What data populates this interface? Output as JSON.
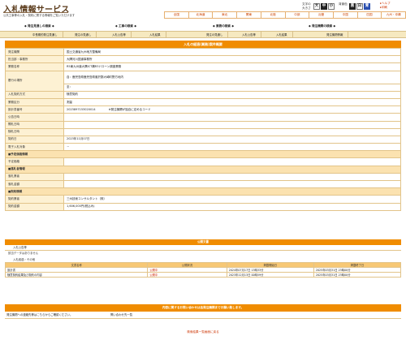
{
  "header": {
    "title": "入札情報サービス",
    "subtitle": "公共工事等の入札・契約に関する情報をご覧いただけます",
    "font_size_label": "文字の大きさ",
    "font_sizes": [
      "大",
      "中",
      "小"
    ],
    "color_label": "背景色",
    "colors": [
      "黒",
      "白",
      "青"
    ],
    "help": "ヘルプ",
    "print": "印刷"
  },
  "regions": [
    "全国",
    "北海道",
    "東北",
    "関東",
    "北陸",
    "中部",
    "近畿",
    "中国",
    "四国",
    "九州・沖縄"
  ],
  "nav": {
    "heads": [
      "◆ 発注見通しの検索 ◆",
      "◆ 工事の検索 ◆",
      "◆ 業務の検索 ◆",
      "◆ 発注機関の検索 ◆"
    ],
    "items": [
      "中長期的発注見通し",
      "発注の見通し",
      "入札公告等",
      "入札結果",
      "発注の見通し",
      "入札公告等",
      "入札結果",
      "発注機関情報"
    ]
  },
  "detail": {
    "title": "入札の経過(業務)案件概要",
    "rows": [
      {
        "label": "発注機関",
        "value": "国土交通省九州地方整備局"
      },
      {
        "label": "担当部・事務所",
        "value": "大隅河川国道事務所"
      },
      {
        "label": "業務名称",
        "value": "R5東九州道大隅ICT構R3ドローン調査業務"
      },
      {
        "label": "履行の場所",
        "value": "自：鹿児島県鹿児島県曽於郡大崎町野方地内",
        "value2": "至："
      },
      {
        "label": "入札契約方式",
        "value": "随意契約"
      },
      {
        "label": "業務区分",
        "value": "測量"
      },
      {
        "label": "設計書番号",
        "value": "2023897153020014",
        "note": "※発注機関が独自に定めるコード"
      },
      {
        "label": "公告日時",
        "value": ""
      },
      {
        "label": "開札日時",
        "value": ""
      },
      {
        "label": "随札日時",
        "value": ""
      },
      {
        "label": "契約日",
        "value": "2023年11月07日"
      },
      {
        "label": "電子入札対象",
        "value": "－"
      }
    ],
    "sections": [
      {
        "title": "■予定価格情報",
        "rows": [
          {
            "label": "予定価格",
            "value": ""
          }
        ]
      },
      {
        "title": "■落札者情報",
        "rows": [
          {
            "label": "落札業者",
            "value": ""
          },
          {
            "label": "落札金額",
            "value": ""
          }
        ]
      },
      {
        "title": "■契約情報",
        "rows": [
          {
            "label": "契約業者",
            "value": "三州技術コンサルタント（株）"
          },
          {
            "label": "契約金額",
            "value": "1,606,000円(税込み)"
          }
        ]
      }
    ]
  },
  "public_info": {
    "title": "公開文書",
    "tender_docs_head": "入札公告等",
    "tender_docs_empty": "該当データはありません",
    "others_head": "入札経過・その他",
    "columns": [
      "文書名称",
      "公開状況",
      "掲載開始日",
      "掲載終了日"
    ],
    "rows": [
      {
        "name": "設計書",
        "status": "公開中",
        "start": "2024年07月17日 13時33分",
        "end": "2025年03月31日 23時00分"
      },
      {
        "name": "随意契約結果及び契約の内容",
        "status": "公開中",
        "start": "2023年12月13日 00時59分",
        "end": "2025年03月31日 23時00分"
      }
    ]
  },
  "contact": {
    "title": "内容に関するお問い合わせは各発注機関までお願い致します。",
    "left": "発注機関への連絡先等はこちらからご確認ください。",
    "right": "問い合わせ先一覧"
  },
  "back_link": "検索結果一覧画面に戻る"
}
